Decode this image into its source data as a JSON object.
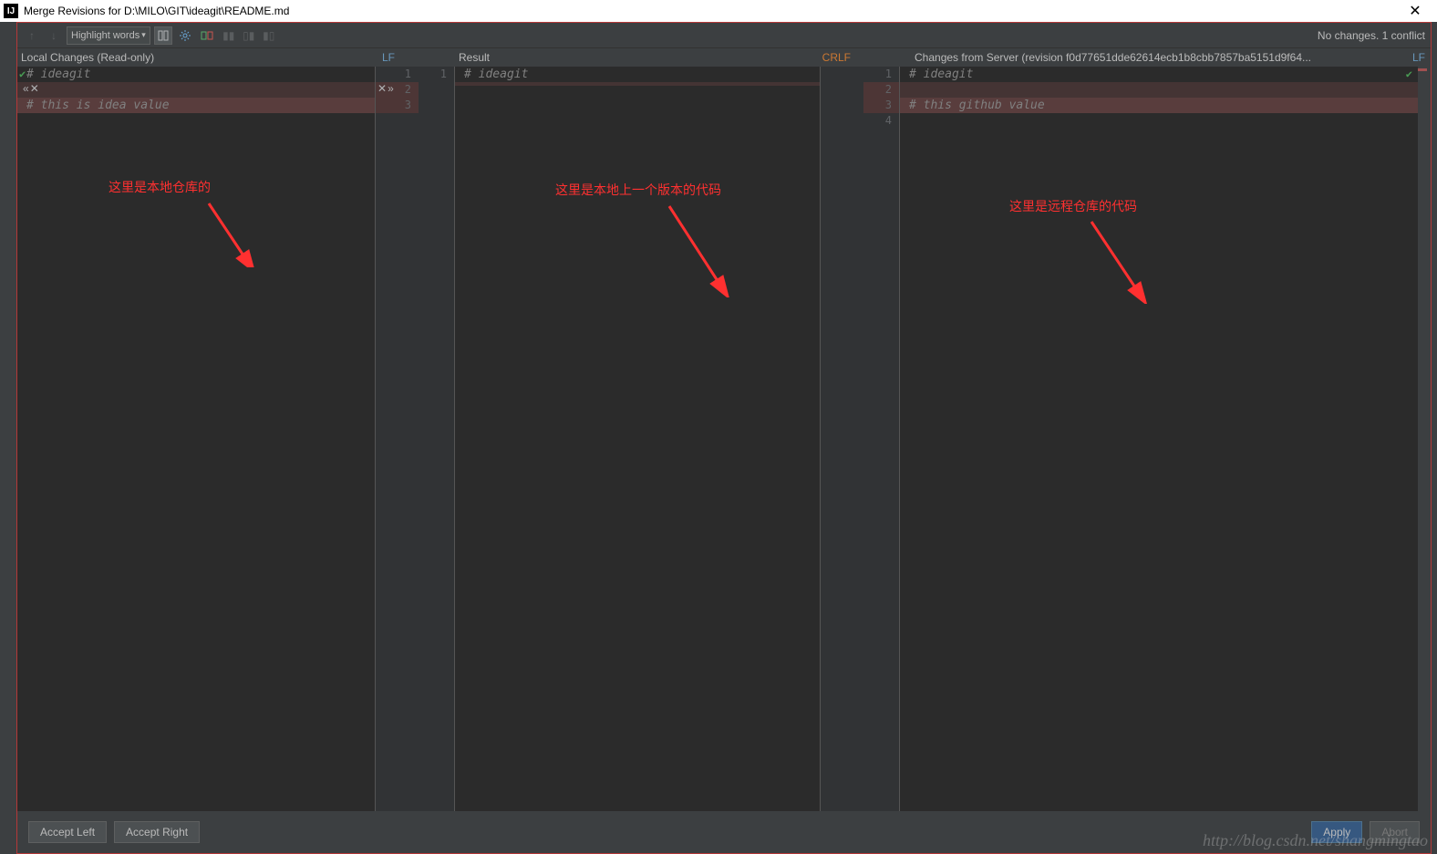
{
  "titlebar": {
    "icon_text": "IJ",
    "title": "Merge Revisions for D:\\MILO\\GIT\\ideagit\\README.md"
  },
  "toolbar": {
    "highlight_label": "Highlight words",
    "status": "No changes. 1 conflict"
  },
  "headers": {
    "left_label": "Local Changes (Read-only)",
    "left_encoding": "LF",
    "mid_label": "Result",
    "mid_encoding": "CRLF",
    "right_label": "Changes from Server (revision f0d77651dde62614ecb1b8cbb7857ba5151d9f64...",
    "right_encoding": "LF"
  },
  "code": {
    "left": {
      "line1": "# ideagit",
      "line2": "",
      "line3": "# this is idea value"
    },
    "mid": {
      "line1": "# ideagit"
    },
    "right": {
      "line1": "# ideagit",
      "line2": "",
      "line3": "# this github value"
    },
    "gutters": {
      "left_nums": [
        "1",
        "2",
        "3"
      ],
      "mid_nums": [
        "1"
      ],
      "right_nums": [
        "1",
        "2",
        "3",
        "4"
      ]
    }
  },
  "annotations": {
    "left": "这里是本地仓库的",
    "mid": "这里是本地上一个版本的代码",
    "right": "这里是远程仓库的代码"
  },
  "buttons": {
    "accept_left": "Accept Left",
    "accept_right": "Accept Right",
    "apply": "Apply",
    "abort": "Abort"
  },
  "watermark": "http://blog.csdn.net/shangmingtao"
}
